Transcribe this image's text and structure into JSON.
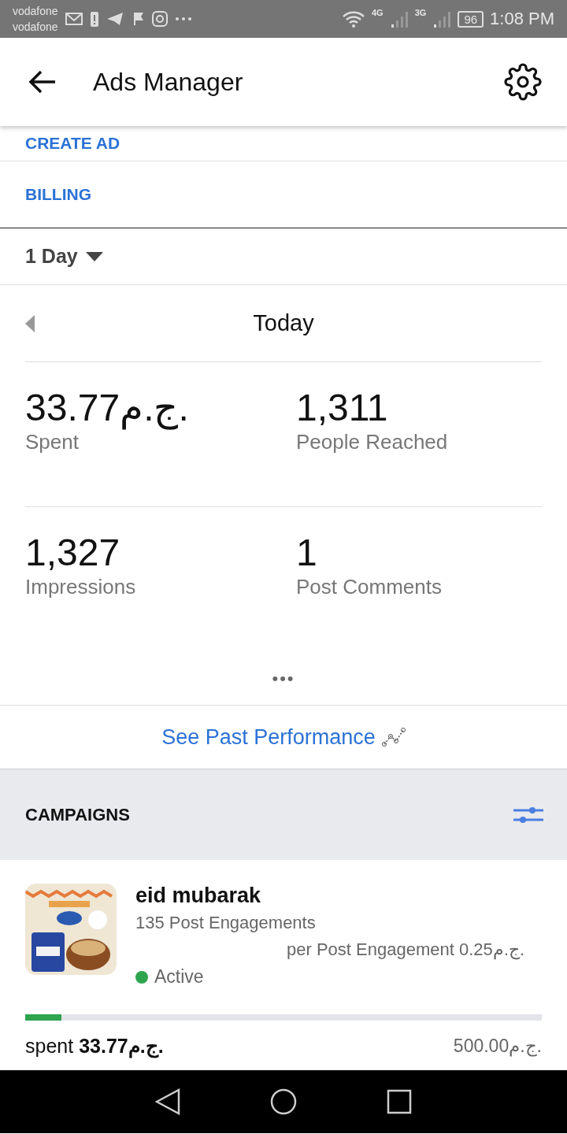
{
  "status_bar": {
    "carriers": [
      "vodafone",
      "vodafone"
    ],
    "network_labels": [
      "4G",
      "3G"
    ],
    "battery": "96",
    "time": "1:08 PM"
  },
  "header": {
    "title": "Ads Manager"
  },
  "menu_links": [
    {
      "label": "CREATE AD"
    },
    {
      "label": "BILLING"
    }
  ],
  "date_range": {
    "label": "1 Day"
  },
  "period": {
    "label": "Today"
  },
  "stats": [
    {
      "value": "33.77ج.م.",
      "label": "Spent"
    },
    {
      "value": "1,311",
      "label": "People Reached"
    },
    {
      "value": "1,327",
      "label": "Impressions"
    },
    {
      "value": "1",
      "label": "Post Comments"
    }
  ],
  "more": "•••",
  "past_performance": {
    "label": "See Past Performance"
  },
  "campaigns": {
    "title": "CAMPAIGNS",
    "items": [
      {
        "name": "eid mubarak",
        "result": "135 Post Engagements",
        "cost": "per Post Engagement 0.25ج.م.",
        "status": "Active",
        "color": "#2ea44f",
        "level": 0.07,
        "spent_label": "spent",
        "spent": "33.77ج.م.",
        "budget": "500.00ج.م."
      }
    ]
  }
}
